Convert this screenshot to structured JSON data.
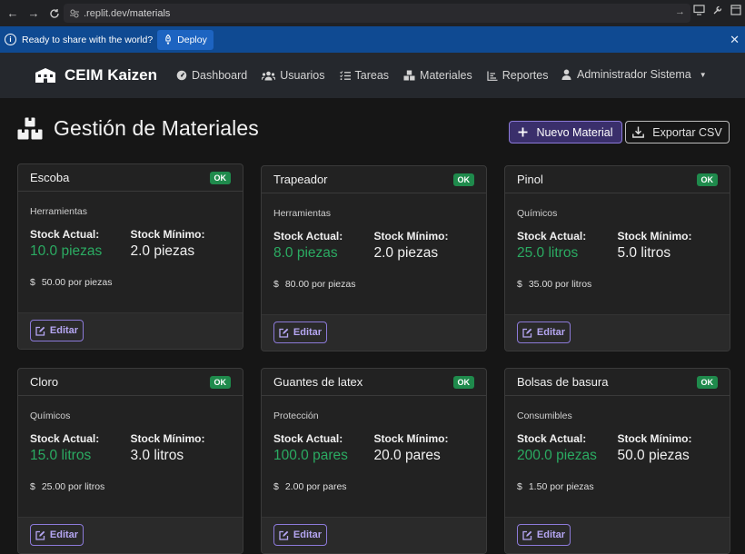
{
  "browser": {
    "url_prefix": ".replit.dev",
    "url_path": "/materials"
  },
  "banner": {
    "text": "Ready to share with the world?",
    "deploy_label": "Deploy"
  },
  "navbar": {
    "brand": "CEIM Kaizen",
    "items": [
      {
        "label": "Dashboard",
        "icon": "gauge-icon"
      },
      {
        "label": "Usuarios",
        "icon": "users-icon"
      },
      {
        "label": "Tareas",
        "icon": "tasks-icon"
      },
      {
        "label": "Materiales",
        "icon": "boxes-icon"
      },
      {
        "label": "Reportes",
        "icon": "chart-icon"
      }
    ],
    "user": "Administrador Sistema"
  },
  "page": {
    "title": "Gestión de Materiales",
    "new_button": "Nuevo Material",
    "export_button": "Exportar CSV"
  },
  "labels": {
    "stock_actual": "Stock Actual:",
    "stock_minimo": "Stock Mínimo:",
    "edit": "Editar",
    "dollar": "$"
  },
  "materials": [
    {
      "name": "Escoba",
      "status": "OK",
      "category": "Herramientas",
      "stock_actual": "10.0 piezas",
      "stock_minimo": "2.0 piezas",
      "price": "$50.00 por piezas"
    },
    {
      "name": "Trapeador",
      "status": "OK",
      "category": "Herramientas",
      "stock_actual": "8.0 piezas",
      "stock_minimo": "2.0 piezas",
      "price": "$80.00 por piezas"
    },
    {
      "name": "Pinol",
      "status": "OK",
      "category": "Químicos",
      "stock_actual": "25.0 litros",
      "stock_minimo": "5.0 litros",
      "price": "$35.00 por litros"
    },
    {
      "name": "Cloro",
      "status": "OK",
      "category": "Químicos",
      "stock_actual": "15.0 litros",
      "stock_minimo": "3.0 litros",
      "price": "$25.00 por litros"
    },
    {
      "name": "Guantes de latex",
      "status": "OK",
      "category": "Protección",
      "stock_actual": "100.0 pares",
      "stock_minimo": "20.0 pares",
      "price": "$2.00 por pares"
    },
    {
      "name": "Bolsas de basura",
      "status": "OK",
      "category": "Consumibles",
      "stock_actual": "200.0 piezas",
      "stock_minimo": "50.0 piezas",
      "price": "$1.50 por piezas"
    }
  ],
  "colors": {
    "accent": "#8c7ad9",
    "ok_badge": "#1f8a4c",
    "stock_green": "#2bab62"
  }
}
